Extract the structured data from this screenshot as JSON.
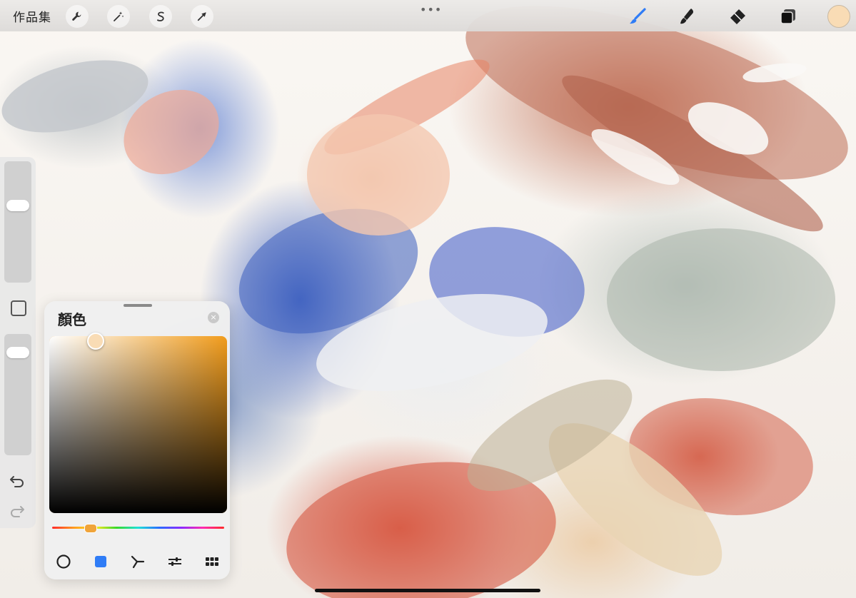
{
  "topbar": {
    "gallery_label": "作品集",
    "left_tools": [
      "wrench-icon",
      "magic-wand-icon",
      "selection-s-icon",
      "arrow-cursor-icon"
    ],
    "handle": "•••",
    "right_tools": [
      "brush-icon",
      "smudge-icon",
      "eraser-icon",
      "layers-icon"
    ],
    "current_color": "#f9dcb5",
    "accent_color": "#2f7cf6"
  },
  "sidebar": {
    "size_slider_level": 0.65,
    "opacity_slider_level": 0.88,
    "icons": [
      "modify-square-icon",
      "undo-icon",
      "redo-icon"
    ]
  },
  "color_panel": {
    "title": "顏色",
    "close_glyph": "×",
    "hue_color": "#f29d1d",
    "hue_position": 0.22,
    "saturation": 0.26,
    "brightness": 0.97,
    "modes": [
      "disc-icon",
      "classic-icon",
      "harmony-icon",
      "value-icon",
      "palettes-icon"
    ],
    "active_mode": "classic-icon"
  }
}
